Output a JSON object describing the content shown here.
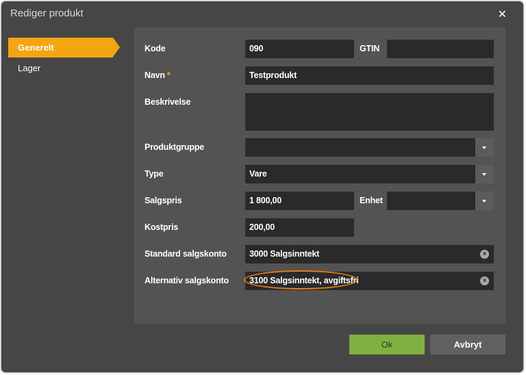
{
  "dialog": {
    "title": "Rediger produkt"
  },
  "nav": {
    "items": [
      {
        "label": "Generelt"
      },
      {
        "label": "Lager"
      }
    ]
  },
  "form": {
    "kode": {
      "label": "Kode",
      "value": "090"
    },
    "gtin": {
      "label": "GTIN",
      "value": ""
    },
    "navn": {
      "label": "Navn",
      "required_mark": "*",
      "value": "Testprodukt"
    },
    "beskrivelse": {
      "label": "Beskrivelse",
      "value": ""
    },
    "produktgruppe": {
      "label": "Produktgruppe",
      "value": ""
    },
    "type": {
      "label": "Type",
      "value": "Vare"
    },
    "salgspris": {
      "label": "Salgspris",
      "value": "1 800,00"
    },
    "enhet": {
      "label": "Enhet",
      "value": ""
    },
    "kostpris": {
      "label": "Kostpris",
      "value": "200,00"
    },
    "standard_salgskonto": {
      "label": "Standard salgskonto",
      "value": "3000 Salgsinntekt"
    },
    "alternativ_salgskonto": {
      "label": "Alternativ salgskonto",
      "value": "3100 Salgsinntekt, avgiftsfri"
    }
  },
  "buttons": {
    "ok": "Ok",
    "cancel": "Avbryt"
  }
}
